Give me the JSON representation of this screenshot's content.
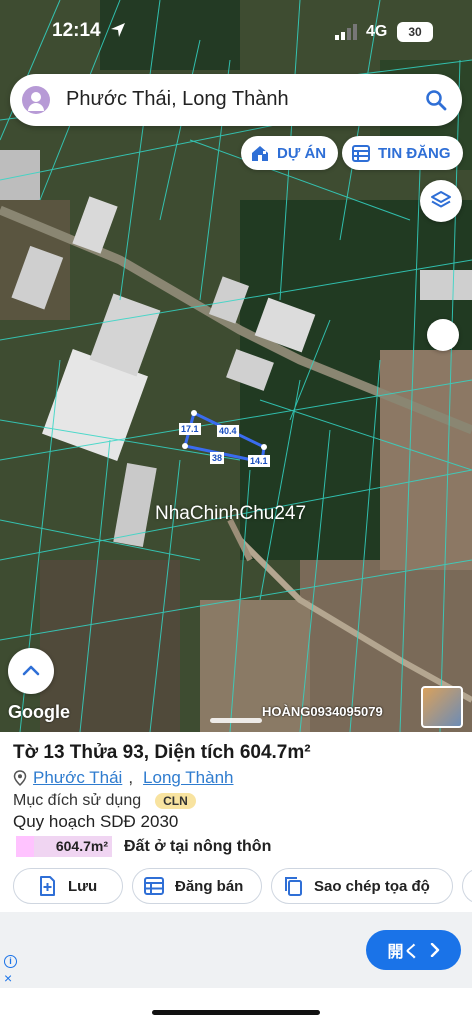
{
  "status_bar": {
    "time": "12:14",
    "network": "4G",
    "battery": "30"
  },
  "search": {
    "query": "Phước Thái, Long Thành"
  },
  "map": {
    "chips": [
      {
        "label": "DỰ ÁN",
        "icon": "home-icon"
      },
      {
        "label": "TIN ĐĂNG",
        "icon": "calendar-icon"
      }
    ],
    "plot_labels": {
      "left": "17.1",
      "top": "40.4",
      "bottom": "38",
      "right": "14.1"
    },
    "watermark": "NhaChinhChu247",
    "google_logo": "Google",
    "phone_label": "HOÀNG0934095079"
  },
  "parcel": {
    "title": "Tờ 13 Thửa 93, Diện tích 604.7m²",
    "address": {
      "ward": "Phước Thái",
      "district": "Long Thành",
      "separator": ","
    },
    "purpose_label": "Mục đích sử dụng",
    "purpose_code": "CLN",
    "plan_label": "Quy hoạch SDĐ 2030",
    "plan_area": "604.7m²",
    "plan_use": "Đất ở tại nông thôn"
  },
  "actions": {
    "save": "Lưu",
    "post_sale": "Đăng bán",
    "copy_coords": "Sao chép tọa độ"
  },
  "ad": {
    "open_label": "開く",
    "info": "i",
    "close": "×"
  },
  "colors": {
    "accent": "#2f6fd6",
    "plan_area": "#f0d5f2",
    "badge": "#f8e3a0",
    "ad_button": "#1a73e8"
  }
}
